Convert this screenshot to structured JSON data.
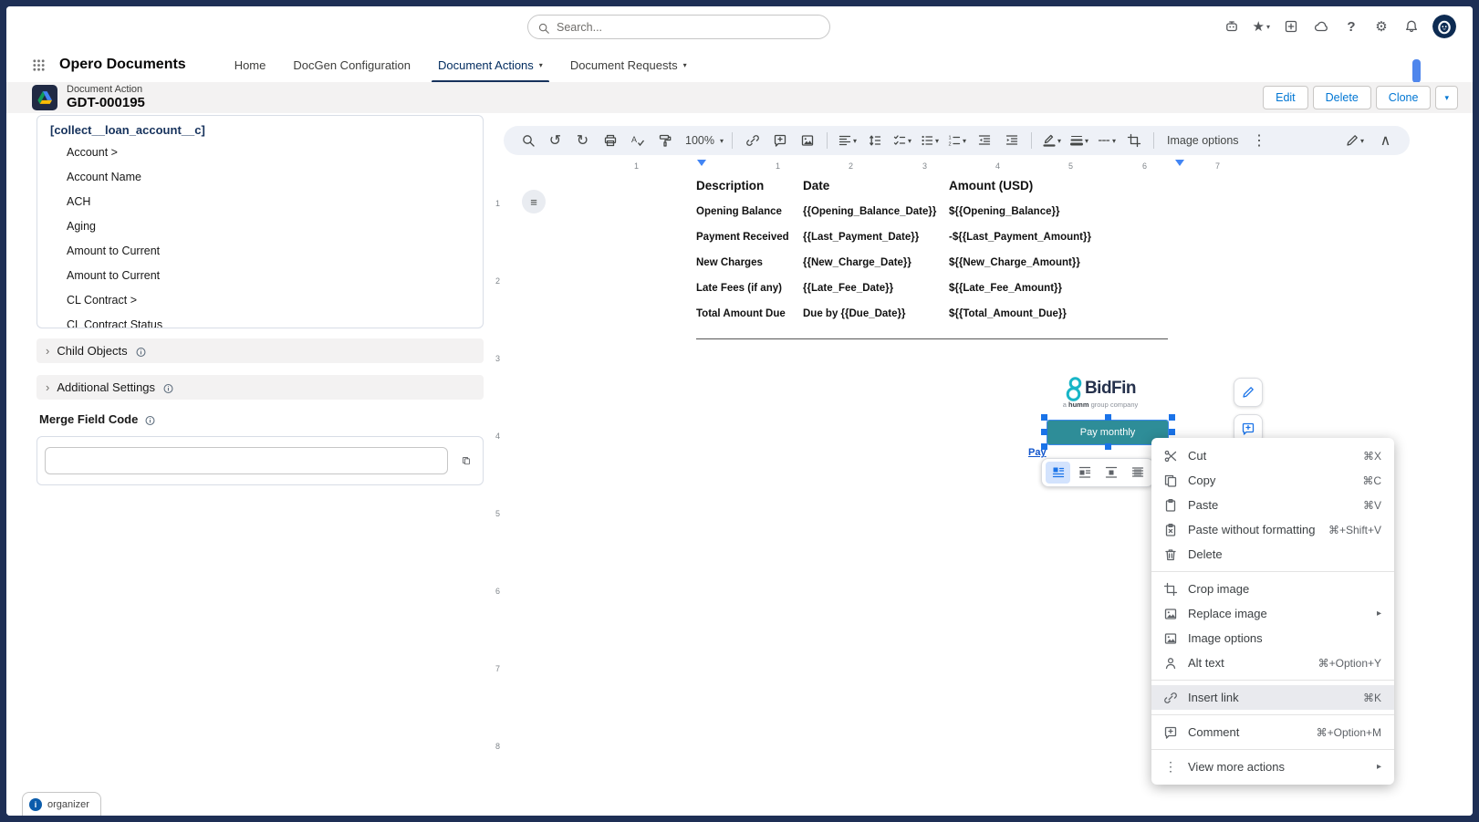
{
  "colors": {
    "accent": "#0176d3",
    "selection_blue": "#1a73e8",
    "pay_button_teal": "#2e8d98",
    "link_blue": "#1155cc",
    "brand_teal": "#18b5c7",
    "nav_underline": "#16325c"
  },
  "icons": {
    "search": "svg:search",
    "undo": "↺",
    "redo": "↻",
    "print": "svg:print",
    "spellcheck": "svg:spell",
    "paint-format": "svg:paint",
    "link": "svg:link",
    "add-comment": "svg:comment_add",
    "insert-image": "svg:image",
    "align": "svg:align",
    "line-spacing": "svg:spacing",
    "checklist": "svg:checklist",
    "bulleted-list": "svg:bullets",
    "numbered-list": "svg:numbers",
    "decrease-indent": "svg:outdent",
    "increase-indent": "svg:indent",
    "border-color": "svg:pen_color",
    "border-weight": "svg:weight",
    "border-dash": "svg:dash",
    "crop": "svg:crop",
    "more-vert": "⋮",
    "edit-pen": "svg:pen",
    "collapse": "∧",
    "chevron-down": "▾",
    "star": "★",
    "gear": "⚙",
    "help": "?",
    "robot": "svg:robot",
    "cloud": "svg:cloud",
    "bell": "svg:bell",
    "plus-box": "svg:plusbox",
    "info": "svg:info",
    "waffle": "svg:waffle",
    "cut": "svg:scissors",
    "copy": "svg:copy",
    "paste": "svg:clipboard",
    "paste-plain": "svg:clipboard_x",
    "trash": "svg:trash",
    "alt-text": "svg:person",
    "submenu-arrow": "▸",
    "outline": "≡",
    "in-line": "svg:wrap_inline",
    "wrap-text": "svg:wrap_wrap",
    "break-text": "svg:wrap_break",
    "behind-text": "svg:wrap_behind",
    "record": "svg:drive",
    "bidfin-mark": "svg:bidfin8",
    "avatar": "svg:astro",
    "copy-code": "svg:copy"
  },
  "utility_bar": {
    "search_placeholder": "Search..."
  },
  "nav": {
    "app_name": "Opero Documents",
    "tabs": [
      {
        "label": "Home"
      },
      {
        "label": "DocGen Configuration"
      },
      {
        "label": "Document Actions",
        "chevron": true,
        "active": true
      },
      {
        "label": "Document Requests",
        "chevron": true
      }
    ]
  },
  "record_header": {
    "entity": "Document Action",
    "name": "GDT-000195",
    "actions": [
      "Edit",
      "Delete",
      "Clone"
    ]
  },
  "left_panel": {
    "field_list": {
      "header": "[collect__loan_account__c]",
      "items": [
        "Account >",
        "Account Name",
        "ACH",
        "Aging",
        "Amount to Current",
        "Amount to Current",
        "CL Contract >",
        "CL Contract Status"
      ]
    },
    "child_objects_label": "Child Objects",
    "additional_settings_label": "Additional Settings",
    "merge_field": {
      "label": "Merge Field Code",
      "value": ""
    }
  },
  "docs": {
    "toolbar": {
      "items": [
        {
          "name": "search",
          "icon": "search"
        },
        {
          "name": "undo",
          "icon": "undo"
        },
        {
          "name": "redo",
          "icon": "redo"
        },
        {
          "name": "print",
          "icon": "print"
        },
        {
          "name": "spellcheck",
          "icon": "spellcheck"
        },
        {
          "name": "paint-format",
          "icon": "paint-format"
        },
        {
          "name": "zoom-select",
          "text": "100%",
          "chevron": true
        },
        {
          "sep": true
        },
        {
          "name": "insert-link",
          "icon": "link"
        },
        {
          "name": "add-comment",
          "icon": "add-comment"
        },
        {
          "name": "insert-image",
          "icon": "insert-image"
        },
        {
          "sep": true
        },
        {
          "name": "align",
          "icon": "align",
          "chevron": true
        },
        {
          "name": "line-spacing",
          "icon": "line-spacing"
        },
        {
          "name": "checklist",
          "icon": "checklist",
          "chevron": true
        },
        {
          "name": "bulleted-list",
          "icon": "bulleted-list",
          "chevron": true
        },
        {
          "name": "numbered-list",
          "icon": "numbered-list",
          "chevron": true
        },
        {
          "name": "decrease-indent",
          "icon": "decrease-indent"
        },
        {
          "name": "increase-indent",
          "icon": "increase-indent"
        },
        {
          "sep": true
        },
        {
          "name": "border-color",
          "icon": "border-color",
          "chevron": true
        },
        {
          "name": "border-weight",
          "icon": "border-weight",
          "chevron": true
        },
        {
          "name": "border-dash",
          "icon": "border-dash",
          "chevron": true
        },
        {
          "name": "crop-image",
          "icon": "crop"
        },
        {
          "sep": true
        },
        {
          "name": "image-options",
          "text": "Image options"
        },
        {
          "name": "more-options",
          "icon": "more-vert"
        }
      ],
      "right_items": [
        {
          "name": "editing-mode",
          "icon": "edit-pen",
          "chevron": true
        },
        {
          "name": "collapse-toolbar",
          "icon": "collapse"
        }
      ]
    },
    "ruler": {
      "h_numbers": [
        "1",
        "1",
        "2",
        "3",
        "4",
        "5",
        "6",
        "7"
      ],
      "v_numbers": [
        "1",
        "2",
        "3",
        "4",
        "5",
        "6",
        "7",
        "8"
      ]
    },
    "table": {
      "headers": [
        "Description",
        "Date",
        "Amount (USD)"
      ],
      "rows": [
        [
          "Opening Balance",
          "{{Opening_Balance_Date}}",
          "${{Opening_Balance}}"
        ],
        [
          "Payment Received",
          "{{Last_Payment_Date}}",
          "-${{Last_Payment_Amount}}"
        ],
        [
          "New Charges",
          "{{New_Charge_Date}}",
          "${{New_Charge_Amount}}"
        ],
        [
          "Late Fees (if any)",
          "{{Late_Fee_Date}}",
          "${{Late_Fee_Amount}}"
        ],
        [
          "Total Amount Due",
          "Due by {{Due_Date}}",
          "${{Total_Amount_Due}}"
        ]
      ]
    },
    "logo": {
      "brand": "BidFin",
      "tagline_pre": "a ",
      "tagline_bold": "humm",
      "tagline_post": " group company"
    },
    "pay_button": "Pay monthly",
    "pay_link": "Pay",
    "wrap_toolbar": [
      "in-line",
      "wrap-text",
      "break-text",
      "behind-text"
    ]
  },
  "context_menu": {
    "groups": [
      {
        "items": [
          {
            "name": "cut",
            "icon": "cut",
            "label": "Cut",
            "shortcut": "⌘X"
          },
          {
            "name": "copy",
            "icon": "copy",
            "label": "Copy",
            "shortcut": "⌘C"
          },
          {
            "name": "paste",
            "icon": "paste",
            "label": "Paste",
            "shortcut": "⌘V"
          },
          {
            "name": "paste-without-formatting",
            "icon": "paste-plain",
            "label": "Paste without formatting",
            "shortcut": "⌘+Shift+V"
          },
          {
            "name": "delete",
            "icon": "trash",
            "label": "Delete",
            "shortcut": ""
          }
        ]
      },
      {
        "items": [
          {
            "name": "crop-image",
            "icon": "crop",
            "label": "Crop image",
            "shortcut": ""
          },
          {
            "name": "replace-image",
            "icon": "insert-image",
            "label": "Replace image",
            "submenu": true
          },
          {
            "name": "image-options",
            "icon": "insert-image",
            "label": "Image options",
            "shortcut": ""
          },
          {
            "name": "alt-text",
            "icon": "alt-text",
            "label": "Alt text",
            "shortcut": "⌘+Option+Y"
          }
        ]
      },
      {
        "items": [
          {
            "name": "insert-link",
            "icon": "link",
            "label": "Insert link",
            "shortcut": "⌘K",
            "highlighted": true
          }
        ]
      },
      {
        "items": [
          {
            "name": "comment",
            "icon": "add-comment",
            "label": "Comment",
            "shortcut": "⌘+Option+M"
          }
        ]
      },
      {
        "items": [
          {
            "name": "view-more-actions",
            "icon": "more-vert",
            "label": "View more actions",
            "submenu": true
          }
        ]
      }
    ]
  },
  "status_bar": {
    "organizer": "organizer"
  }
}
